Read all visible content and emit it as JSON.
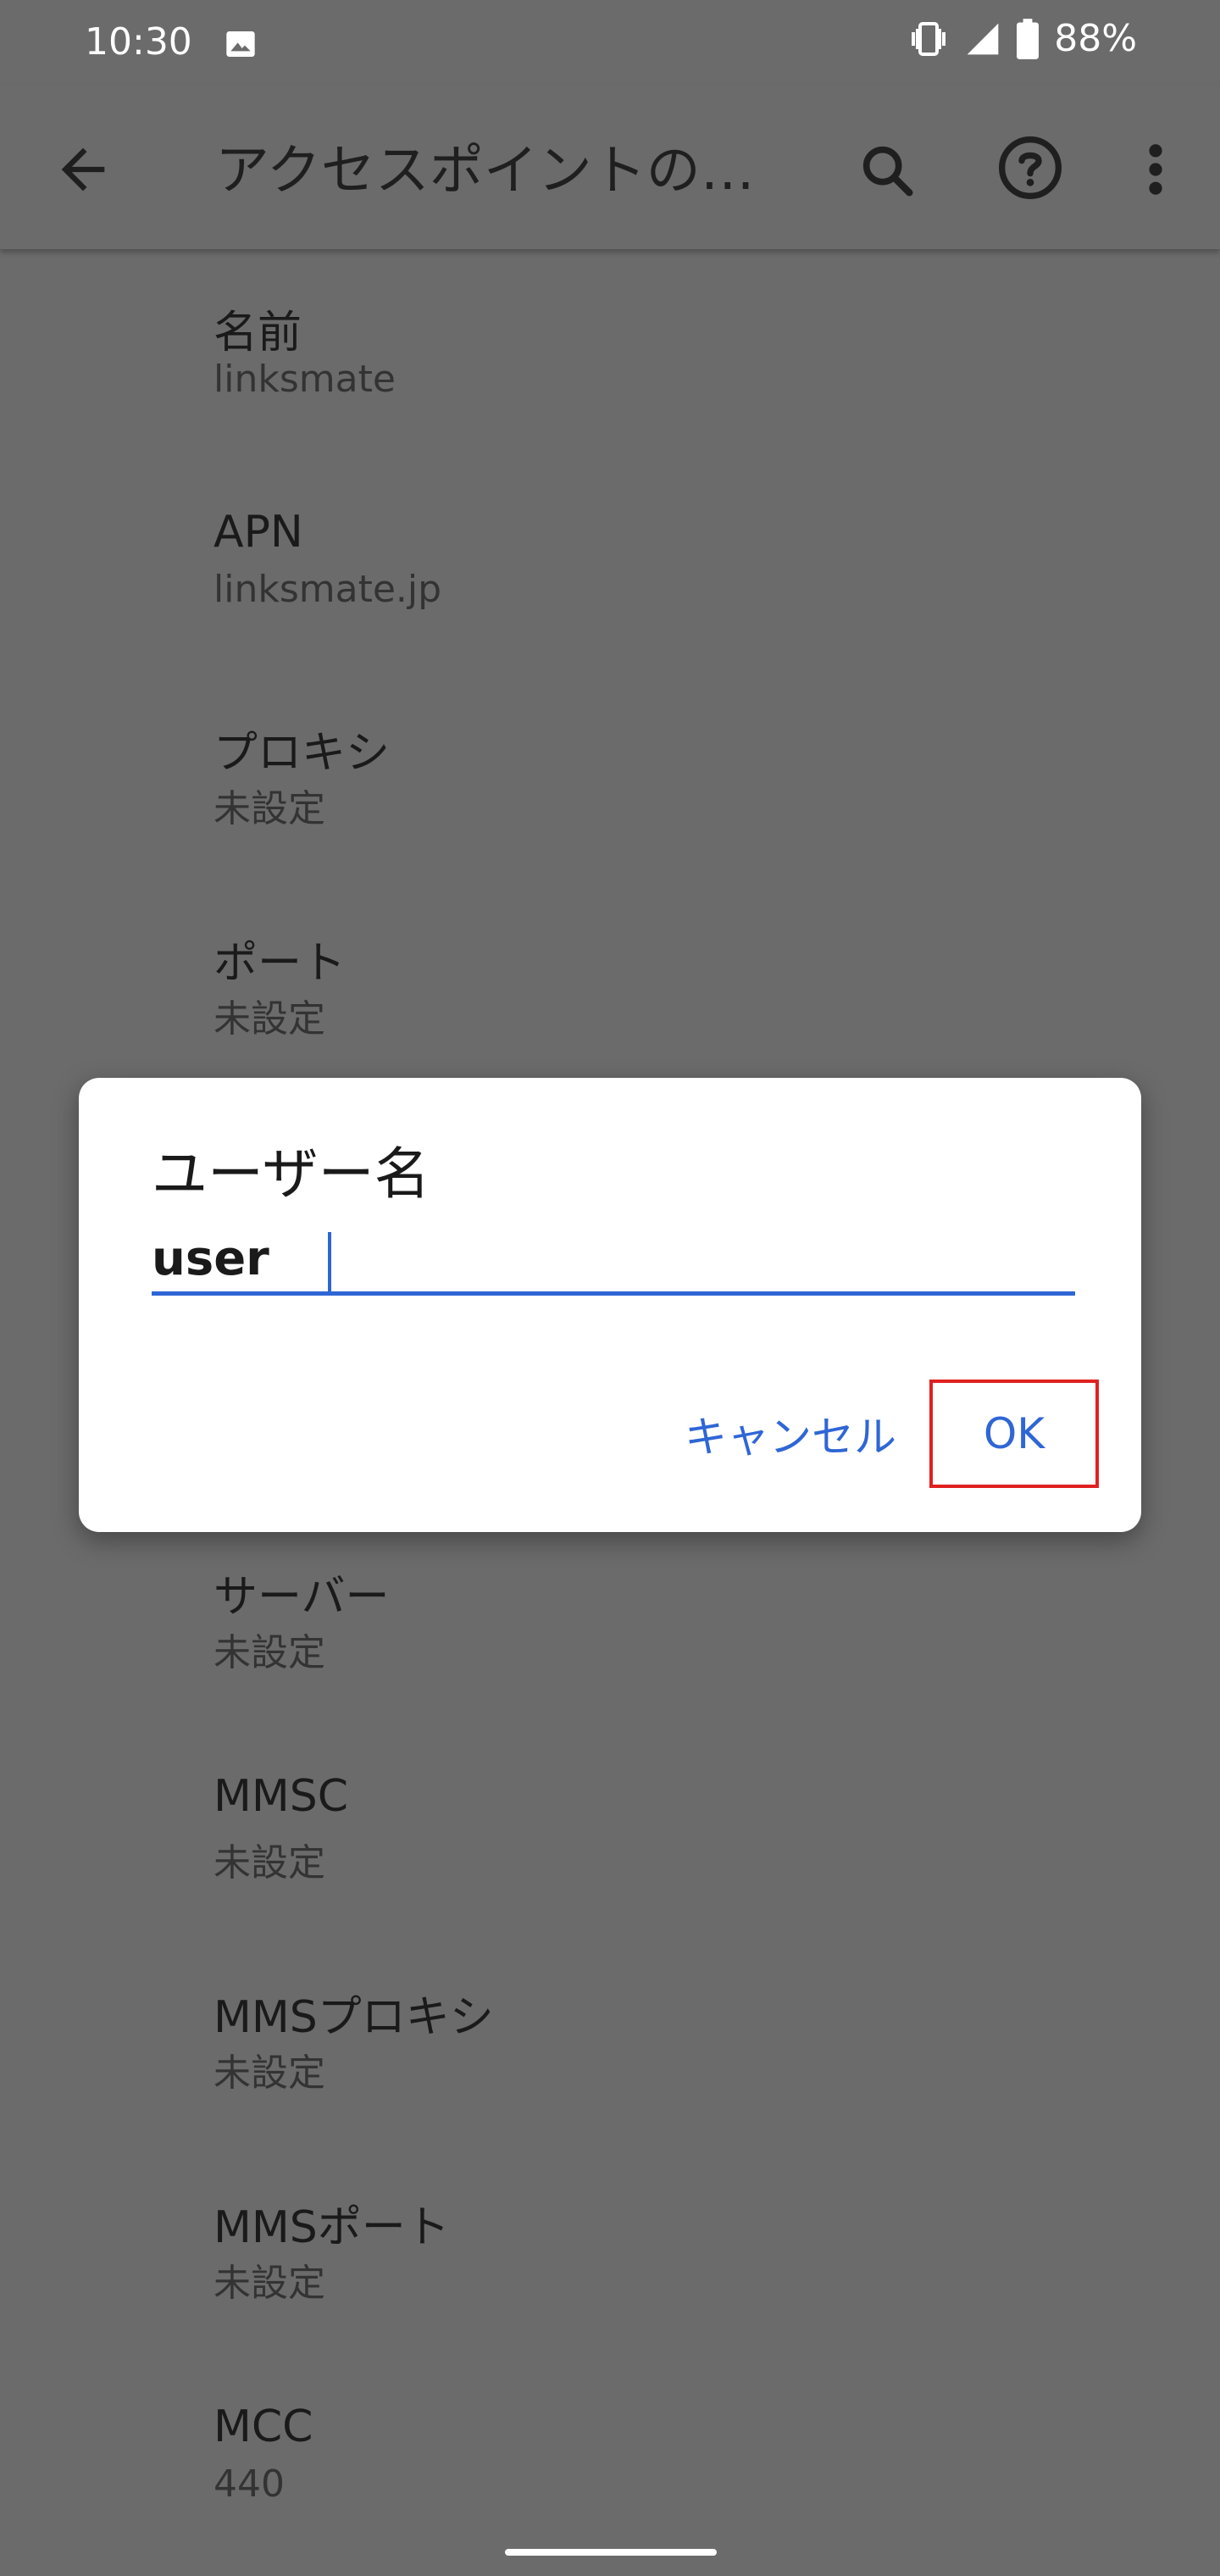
{
  "status_bar": {
    "time": "10:30",
    "battery": "88%",
    "icons": [
      "image-icon",
      "vibrate-icon",
      "signal-icon",
      "battery-icon"
    ]
  },
  "app_bar": {
    "title": "アクセスポイントの…",
    "icons": [
      "back-arrow-icon",
      "search-icon",
      "help-icon",
      "more-vert-icon"
    ]
  },
  "list": {
    "items": [
      {
        "label": "名前",
        "value": "linksmate"
      },
      {
        "label": "APN",
        "value": "linksmate.jp"
      },
      {
        "label": "プロキシ",
        "value": "未設定"
      },
      {
        "label": "ポート",
        "value": "未設定"
      },
      {
        "label": "サーバー",
        "value": "未設定"
      },
      {
        "label": "MMSC",
        "value": "未設定"
      },
      {
        "label": "MMSプロキシ",
        "value": "未設定"
      },
      {
        "label": "MMSポート",
        "value": "未設定"
      },
      {
        "label": "MCC",
        "value": "440"
      }
    ]
  },
  "dialog": {
    "title": "ユーザー名",
    "input_value": "user",
    "cancel_label": "キャンセル",
    "ok_label": "OK"
  },
  "colors": {
    "accent": "#2f66d6",
    "scrim_background": "#6b6b6b",
    "highlight": "#e02020"
  }
}
